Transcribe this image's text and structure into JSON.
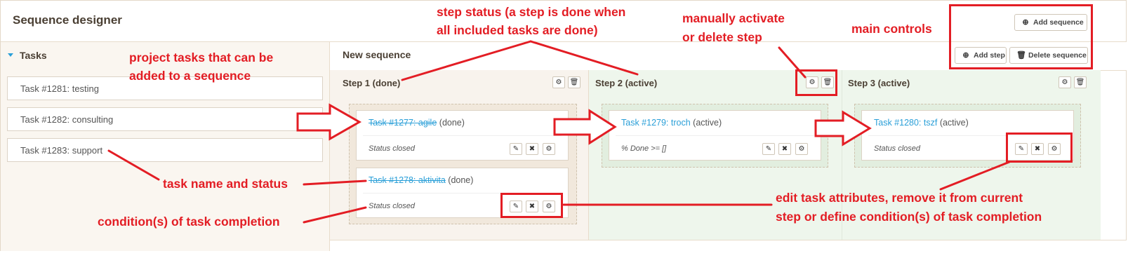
{
  "app": {
    "title": "Sequence designer"
  },
  "sidebar": {
    "heading": "Tasks",
    "tasks": [
      "Task #1281: testing",
      "Task #1282: consulting",
      "Task #1283: support"
    ]
  },
  "sequence": {
    "title": "New sequence",
    "controls": {
      "add_sequence": "Add sequence",
      "add_step": "Add step",
      "delete_sequence": "Delete sequence"
    },
    "steps": [
      {
        "title": "Step 1 (done)",
        "tasks": [
          {
            "link": "Task #1277: agile",
            "status": "(done)",
            "condition": "Status closed"
          },
          {
            "link": "Task #1278: aktivita",
            "status": "(done)",
            "condition": "Status closed"
          }
        ]
      },
      {
        "title": "Step 2 (active)",
        "tasks": [
          {
            "link": "Task #1279: troch",
            "status": "(active)",
            "condition": "% Done >= []"
          }
        ]
      },
      {
        "title": "Step 3 (active)",
        "tasks": [
          {
            "link": "Task #1280: tszf",
            "status": "(active)",
            "condition": "Status closed"
          }
        ]
      }
    ]
  },
  "icons": {
    "activate": "circle-gear-icon",
    "delete": "trash-icon",
    "edit": "pencil-icon",
    "remove": "x-icon",
    "condition": "gear-icon",
    "add": "plus-circle-icon"
  },
  "annotations": {
    "project_tasks_1": "project tasks that can be",
    "project_tasks_2": "added to a sequence",
    "step_status_1": "step status (a step is done when",
    "step_status_2": "all included tasks are done)",
    "manual_1": "manually activate",
    "manual_2": "or delete step",
    "main_controls": "main controls",
    "task_name": "task name and status",
    "conditions": "condition(s) of task completion",
    "edit_1": "edit task attributes, remove it from current",
    "edit_2": "step or define condition(s) of task completion"
  },
  "colors": {
    "annotation": "#e31d24",
    "link": "#2a9fd8",
    "active_step_bg": "#eef6ec",
    "done_step_bg": "#f8f3ed"
  }
}
